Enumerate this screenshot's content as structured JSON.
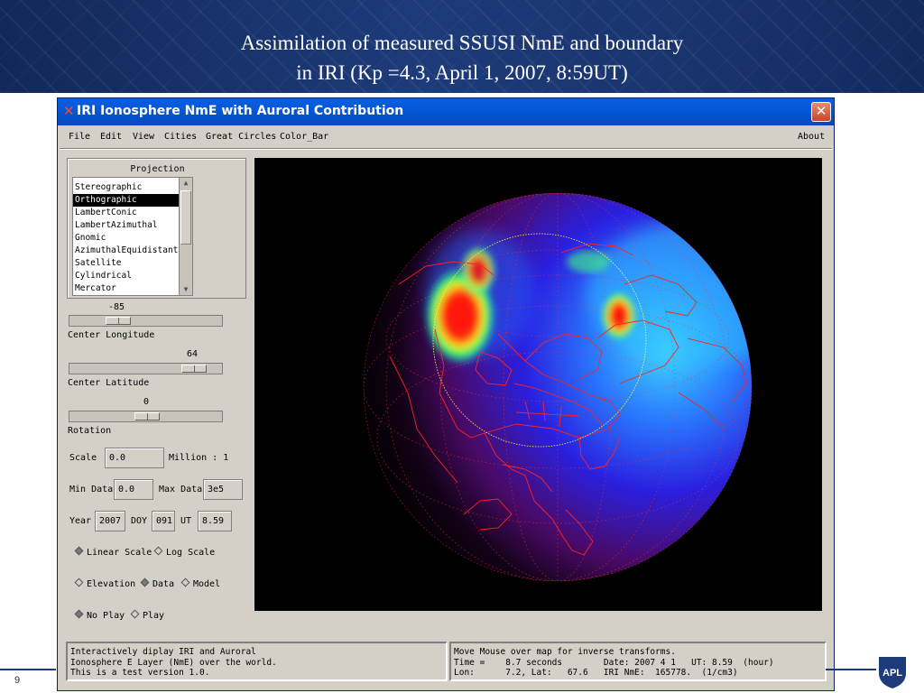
{
  "slide": {
    "title_line1": "Assimilation of measured  SSUSI NmE and boundary",
    "title_line2": "in IRI (Kp =4.3, April 1, 2007, 8:59UT)",
    "page_number": "9",
    "logo_text": "APL"
  },
  "window": {
    "title": "IRI Ionosphere NmE with Auroral Contribution",
    "close_glyph": "✕",
    "app_icon_glyph": "✕"
  },
  "menu": {
    "file": "File",
    "edit": "Edit",
    "view": "View",
    "cities": "Cities",
    "great_circles": "Great Circles",
    "color_bar": "Color_Bar",
    "about": "About"
  },
  "projection": {
    "label": "Projection",
    "items": [
      "Stereographic",
      "Orthographic",
      "LambertConic",
      "LambertAzimuthal",
      "Gnomic",
      "AzimuthalEquidistant",
      "Satellite",
      "Cylindrical",
      "Mercator"
    ],
    "selected": "Orthographic"
  },
  "center_longitude": {
    "value": "-85",
    "label": "Center Longitude"
  },
  "center_latitude": {
    "value": "64",
    "label": "Center Latitude"
  },
  "rotation": {
    "value": "0",
    "label": "Rotation"
  },
  "scale": {
    "label": "Scale",
    "value": "0.0",
    "unit": "Million : 1"
  },
  "data_range": {
    "min_label": "Min Data",
    "min_value": "0.0",
    "max_label": "Max Data",
    "max_value": "3e5"
  },
  "time": {
    "year_label": "Year",
    "year": "2007",
    "doy_label": "DOY",
    "doy": "091",
    "ut_label": "UT",
    "ut": "8.59"
  },
  "scale_mode": {
    "linear": "Linear Scale",
    "log": "Log Scale",
    "selected": "linear"
  },
  "layer_mode": {
    "elevation": "Elevation",
    "data": "Data",
    "model": "Model",
    "selected": "data"
  },
  "play_mode": {
    "no_play": "No Play",
    "play": "Play",
    "selected": "no_play"
  },
  "info_pane": {
    "line1": "Interactively diplay IRI and Auroral",
    "line2": "Ionosphere E Layer (NmE) over the world.",
    "line3": "This is a test version 1.0."
  },
  "status_pane": {
    "line1": "Move Mouse over map for inverse transforms.",
    "line2": "Time =    8.7 seconds        Date: 2007 4 1   UT: 8.59  (hour)",
    "line3": "Lon:      7.2, Lat:   67.6   IRI NmE:  165778.  (1/cm3)"
  },
  "colors": {
    "title_bar": "#0458d8",
    "map_background": "#000000",
    "coastline": "#ff2020",
    "boundary_circle": "#ffff40",
    "slide_header": "#1d3b7a"
  }
}
